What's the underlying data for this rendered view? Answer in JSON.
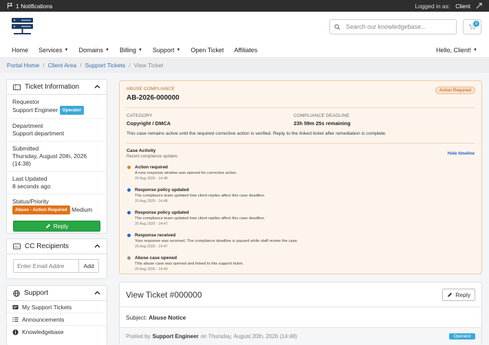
{
  "topbar": {
    "notifications": "1 Notifications",
    "logged_in_label": "Logged in as:",
    "logged_in_user": "Client"
  },
  "search": {
    "placeholder": "Search our knowledgebase..."
  },
  "cart": {
    "count": "0"
  },
  "nav": {
    "items": [
      "Home",
      "Services",
      "Domains",
      "Billing",
      "Support",
      "Open Ticket",
      "Affiliates"
    ],
    "greeting": "Hello, Client!"
  },
  "breadcrumb": [
    "Portal Home",
    "Client Area",
    "Support Tickets",
    "View Ticket"
  ],
  "ticket_info": {
    "title": "Ticket Information",
    "requestor_label": "Requestor",
    "requestor_name": "Support Engineer",
    "requestor_badge": "Operator",
    "department_label": "Department",
    "department_value": "Support department",
    "submitted_label": "Submitted",
    "submitted_date": "Thursday, August 20th, 2026",
    "submitted_time": "(14:38)",
    "updated_label": "Last Updated",
    "updated_value": "8 seconds ago",
    "status_label": "Status/Priority",
    "status_badge": "Abuse - Action Required",
    "priority": "Medium",
    "reply_label": "Reply"
  },
  "cc": {
    "title": "CC Recipients",
    "placeholder": "Enter Email Addre",
    "add_label": "Add"
  },
  "support_panel": {
    "title": "Support",
    "items": [
      "My Support Tickets",
      "Announcements",
      "Knowledgebase"
    ]
  },
  "compliance": {
    "kicker": "ABUSE COMPLIANCE",
    "case_id": "AB-2026-000000",
    "status_pill": "Action Required",
    "category_label": "CATEGORY",
    "category_value": "Copyright / DMCA",
    "deadline_label": "COMPLIANCE DEADLINE",
    "deadline_value": "23h 59m 25s remaining",
    "note": "This case remains active until the required corrective action is verified. Reply to the linked ticket after remediation is complete.",
    "activity_title": "Case Activity",
    "activity_subtitle": "Recent compliance updates",
    "hide_timeline": "Hide timeline",
    "colors": {
      "orange": "#d9861a",
      "blue": "#2463d6",
      "gray": "#8a8f96"
    },
    "timeline": [
      {
        "title": "Action required",
        "desc": "A new response window was opened for corrective action.",
        "time": "20 Aug 2026 - 14:48",
        "dot": "orange"
      },
      {
        "title": "Response policy updated",
        "desc": "The compliance team updated how client replies affect this case deadline.",
        "time": "20 Aug 2026 - 14:48",
        "dot": "blue"
      },
      {
        "title": "Response policy updated",
        "desc": "The compliance team updated how client replies affect this case deadline.",
        "time": "20 Aug 2026 - 14:47",
        "dot": "blue"
      },
      {
        "title": "Response received",
        "desc": "Your response was received. The compliance deadline is paused while staff review the case.",
        "time": "20 Aug 2026 - 14:47",
        "dot": "blue"
      },
      {
        "title": "Abuse case opened",
        "desc": "This abuse case was opened and linked to this support ticket.",
        "time": "20 Aug 2026 - 14:40",
        "dot": "gray"
      }
    ]
  },
  "view_ticket": {
    "title": "View Ticket #000000",
    "reply_label": "Reply",
    "subject_label": "Subject:",
    "subject_value": "Abuse Notice",
    "posted_by": "Posted by",
    "poster": "Support Engineer",
    "posted_on": "on Thursday, August 20th, 2026 (14:48)",
    "poster_badge": "Operator"
  }
}
